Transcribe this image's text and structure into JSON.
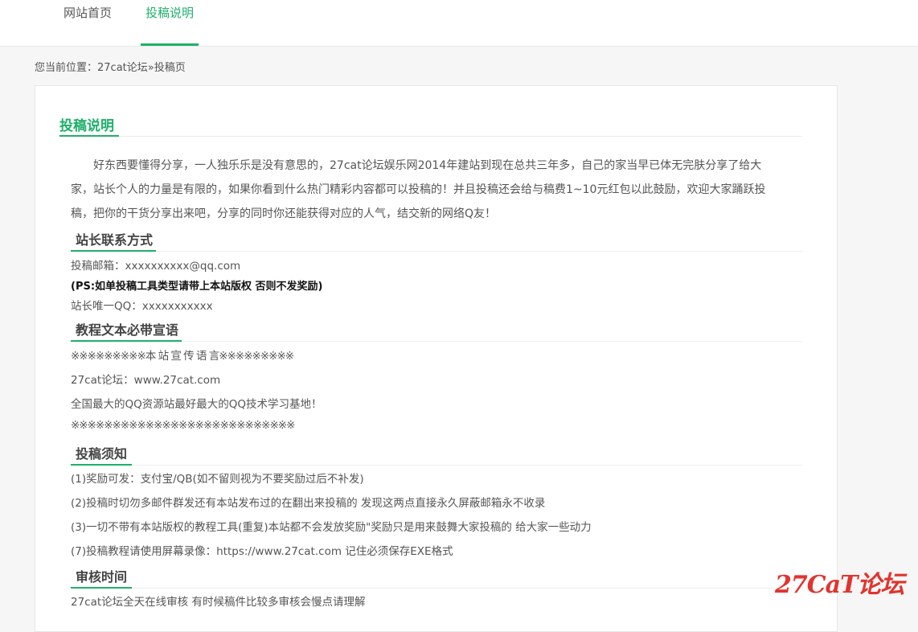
{
  "nav": {
    "items": [
      {
        "label": "网站首页"
      },
      {
        "label": "投稿说明"
      }
    ]
  },
  "breadcrumb": {
    "prefix": "您当前位置：",
    "home": "27cat论坛",
    "sep": "»",
    "current": "投稿页"
  },
  "content": {
    "title": "投稿说明",
    "intro": "好东西要懂得分享，一人独乐乐是没有意思的，27cat论坛娱乐网2014年建站到现在总共三年多，自己的家当早已体无完肤分享了给大家，站长个人的力量是有限的，如果你看到什么热门精彩内容都可以投稿的！并且投稿还会给与稿费1~10元红包以此鼓励，欢迎大家踊跃投稿，把你的干货分享出来吧，分享的同时你还能获得对应的人气，结交新的网络Q友！",
    "sections": [
      {
        "title": "站长联系方式",
        "lines": [
          "投稿邮箱：xxxxxxxxxx@qq.com",
          "(PS:如单投稿工具类型请带上本站版权 否则不发奖励)",
          "站长唯一QQ：xxxxxxxxxxx"
        ]
      },
      {
        "title": "教程文本必带宣语",
        "lines": [
          "※※※※※※※※※本 站 宣 传 语 言※※※※※※※※※",
          "27cat论坛：www.27cat.com",
          "全国最大的QQ资源站最好最大的QQ技术学习基地！",
          "※※※※※※※※※※※※※※※※※※※※※※※※※※※"
        ]
      },
      {
        "title": "投稿须知",
        "lines": [
          "(1)奖励可发：支付宝/QB(如不留则视为不要奖励过后不补发)",
          "(2)投稿时切勿多邮件群发还有本站发布过的在翻出来投稿的 发现这两点直接永久屏蔽邮箱永不收录",
          "(3)一切不带有本站版权的教程工具(重复)本站都不会发放奖励\"奖励只是用来鼓舞大家投稿的 给大家一些动力",
          "(7)投稿教程请使用屏幕录像：https://www.27cat.com 记住必须保存EXE格式"
        ]
      },
      {
        "title": "审核时间",
        "lines": [
          "27cat论坛全天在线审核 有时候稿件比较多审核会慢点请理解"
        ]
      }
    ]
  },
  "watermark": "27CaT论坛"
}
